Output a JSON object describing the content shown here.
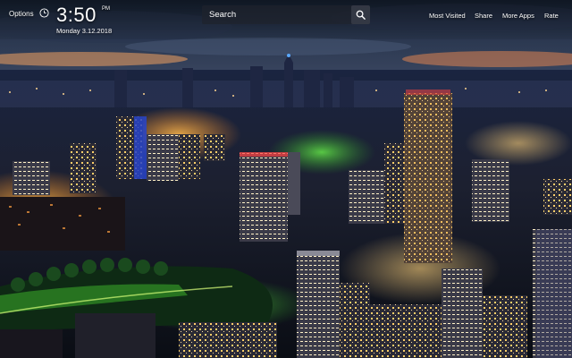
{
  "header": {
    "options_label": "Options",
    "time": "3:50",
    "ampm": "PM",
    "date": "Monday  3.12.2018"
  },
  "search": {
    "placeholder": "Search"
  },
  "nav": {
    "most_visited": "Most Visited",
    "share": "Share",
    "more_apps": "More Apps",
    "rate": "Rate"
  },
  "icons": {
    "clock": "clock-icon",
    "search": "search-icon"
  },
  "colors": {
    "text": "#ffffff",
    "search_bg": "#1e222c",
    "search_btn_bg": "#373c48"
  }
}
